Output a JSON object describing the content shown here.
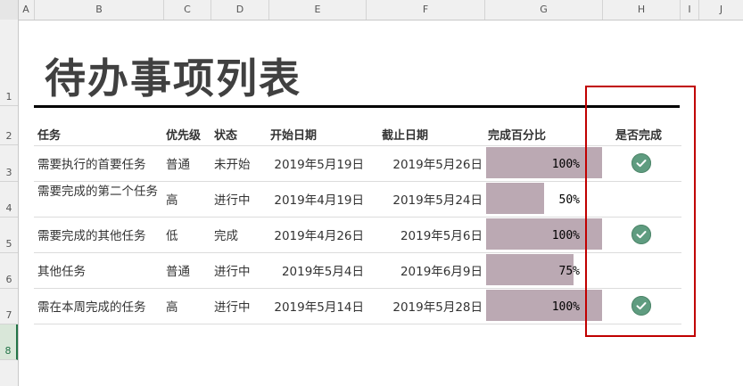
{
  "columns": [
    "A",
    "B",
    "C",
    "D",
    "E",
    "F",
    "G",
    "H",
    "I",
    "J"
  ],
  "rows": [
    "1",
    "2",
    "3",
    "4",
    "5",
    "6",
    "7",
    "8"
  ],
  "title": "待办事项列表",
  "headers": {
    "task": "任务",
    "priority": "优先级",
    "status": "状态",
    "start": "开始日期",
    "end": "截止日期",
    "percent": "完成百分比",
    "done": "是否完成"
  },
  "tasks": [
    {
      "task": "需要执行的首要任务",
      "priority": "普通",
      "status": "未开始",
      "start": "2019年5月19日",
      "end": "2019年5月26日",
      "percent": 1.0,
      "percent_label": "100%",
      "done": true
    },
    {
      "task": "需要完成的第二个任务",
      "priority": "高",
      "status": "进行中",
      "start": "2019年4月19日",
      "end": "2019年5月24日",
      "percent": 0.5,
      "percent_label": "50%",
      "done": false
    },
    {
      "task": "需要完成的其他任务",
      "priority": "低",
      "status": "完成",
      "start": "2019年4月26日",
      "end": "2019年5月6日",
      "percent": 1.0,
      "percent_label": "100%",
      "done": true
    },
    {
      "task": "其他任务",
      "priority": "普通",
      "status": "进行中",
      "start": "2019年5月4日",
      "end": "2019年6月9日",
      "percent": 0.75,
      "percent_label": "75%",
      "done": false
    },
    {
      "task": "需在本周完成的任务",
      "priority": "高",
      "status": "进行中",
      "start": "2019年5月14日",
      "end": "2019年5月28日",
      "percent": 1.0,
      "percent_label": "100%",
      "done": true
    }
  ],
  "colors": {
    "bar": "#bba9b3",
    "check": "#5f9c80",
    "highlight_box": "#c00000"
  },
  "icons": {
    "done": "check-circle-icon"
  }
}
